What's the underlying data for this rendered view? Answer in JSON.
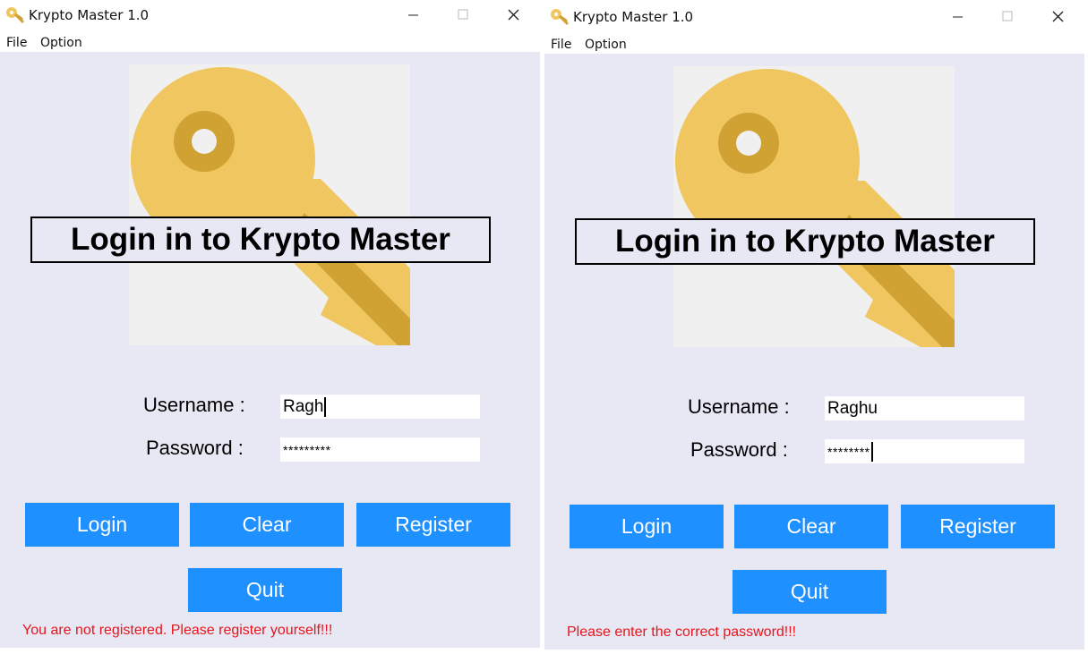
{
  "windows": [
    {
      "title": "Krypto Master 1.0",
      "menu": [
        "File",
        "Option"
      ],
      "banner": "Login in to Krypto Master",
      "username_label": "Username :",
      "password_label": "Password :",
      "username_value": "Ragh",
      "password_value": "*********",
      "caret_in": "username",
      "buttons": {
        "login": "Login",
        "clear": "Clear",
        "register": "Register",
        "quit": "Quit"
      },
      "message": "You are not registered. Please register yourself!!!"
    },
    {
      "title": "Krypto Master 1.0",
      "menu": [
        "File",
        "Option"
      ],
      "banner": "Login in to Krypto Master",
      "username_label": "Username :",
      "password_label": "Password :",
      "username_value": "Raghu",
      "password_value": "********",
      "caret_in": "password",
      "buttons": {
        "login": "Login",
        "clear": "Clear",
        "register": "Register",
        "quit": "Quit"
      },
      "message": "Please enter the correct password!!!"
    }
  ],
  "colors": {
    "client_bg": "#e7e8f3",
    "button_bg": "#1e90ff",
    "error_text": "#e8141b",
    "key_gold": "#f0c660",
    "key_dark_gold": "#d0a234"
  },
  "icons": {
    "app": "key-icon",
    "logo": "key-icon"
  }
}
